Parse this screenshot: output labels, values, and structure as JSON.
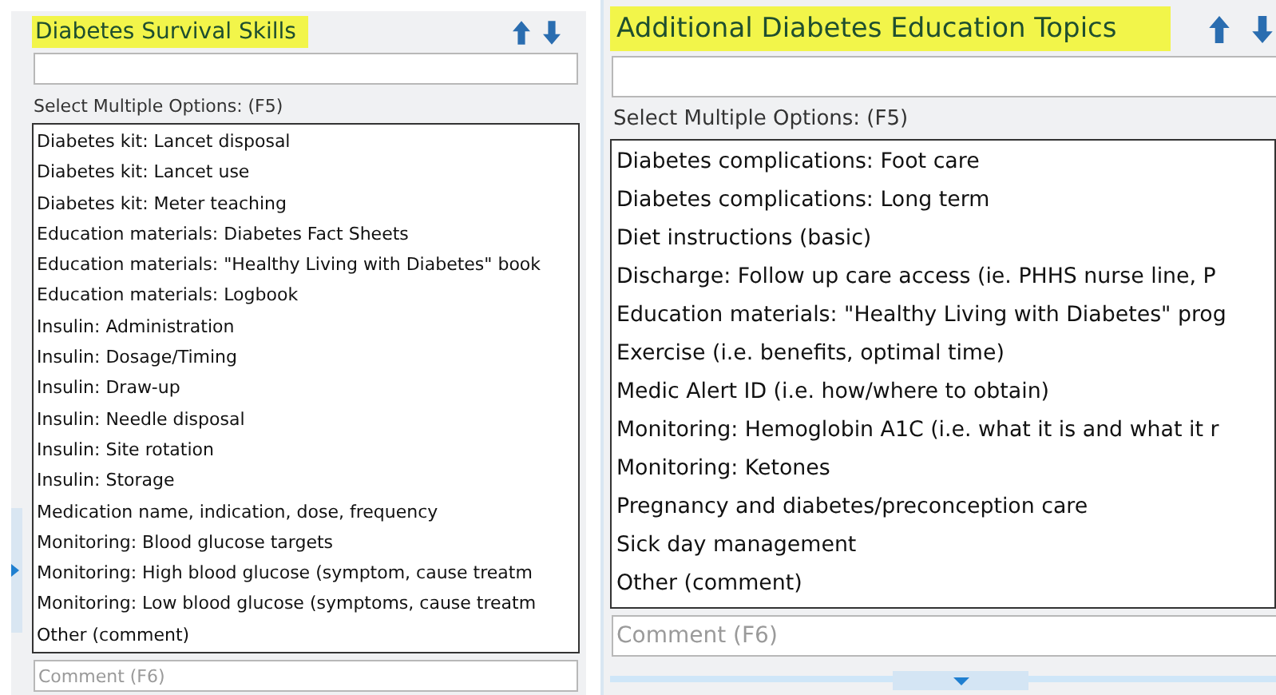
{
  "panels": [
    {
      "title": "Diabetes Survival Skills",
      "options_label": "Select Multiple Options: (F5)",
      "options": [
        "Diabetes kit: Lancet disposal",
        "Diabetes kit: Lancet use",
        "Diabetes kit: Meter teaching",
        "Education materials: Diabetes Fact Sheets",
        "Education materials: \"Healthy Living with Diabetes\" book",
        "Education materials: Logbook",
        "Insulin: Administration",
        "Insulin: Dosage/Timing",
        "Insulin: Draw-up",
        "Insulin: Needle disposal",
        "Insulin: Site rotation",
        "Insulin: Storage",
        "Medication name, indication, dose, frequency",
        "Monitoring: Blood glucose targets",
        "Monitoring: High blood glucose (symptom, cause treatm",
        "Monitoring: Low blood glucose (symptoms, cause treatm",
        "Other (comment)"
      ],
      "comment": {
        "placeholder": "Comment (F6)"
      }
    },
    {
      "title": "Additional Diabetes Education Topics",
      "options_label": "Select Multiple Options: (F5)",
      "options": [
        "Diabetes complications: Foot care",
        "Diabetes complications: Long term",
        "Diet instructions (basic)",
        "Discharge: Follow up care access (ie. PHHS nurse line, P",
        "Education materials: \"Healthy Living with Diabetes\" prog",
        "Exercise (i.e. benefits, optimal time)",
        "Medic Alert ID (i.e. how/where to obtain)",
        "Monitoring: Hemoglobin A1C (i.e. what it is and what it r",
        "Monitoring: Ketones",
        "Pregnancy and diabetes/preconception care",
        "Sick day management",
        "Other (comment)"
      ],
      "comment": {
        "placeholder": "Comment (F6)"
      }
    }
  ]
}
